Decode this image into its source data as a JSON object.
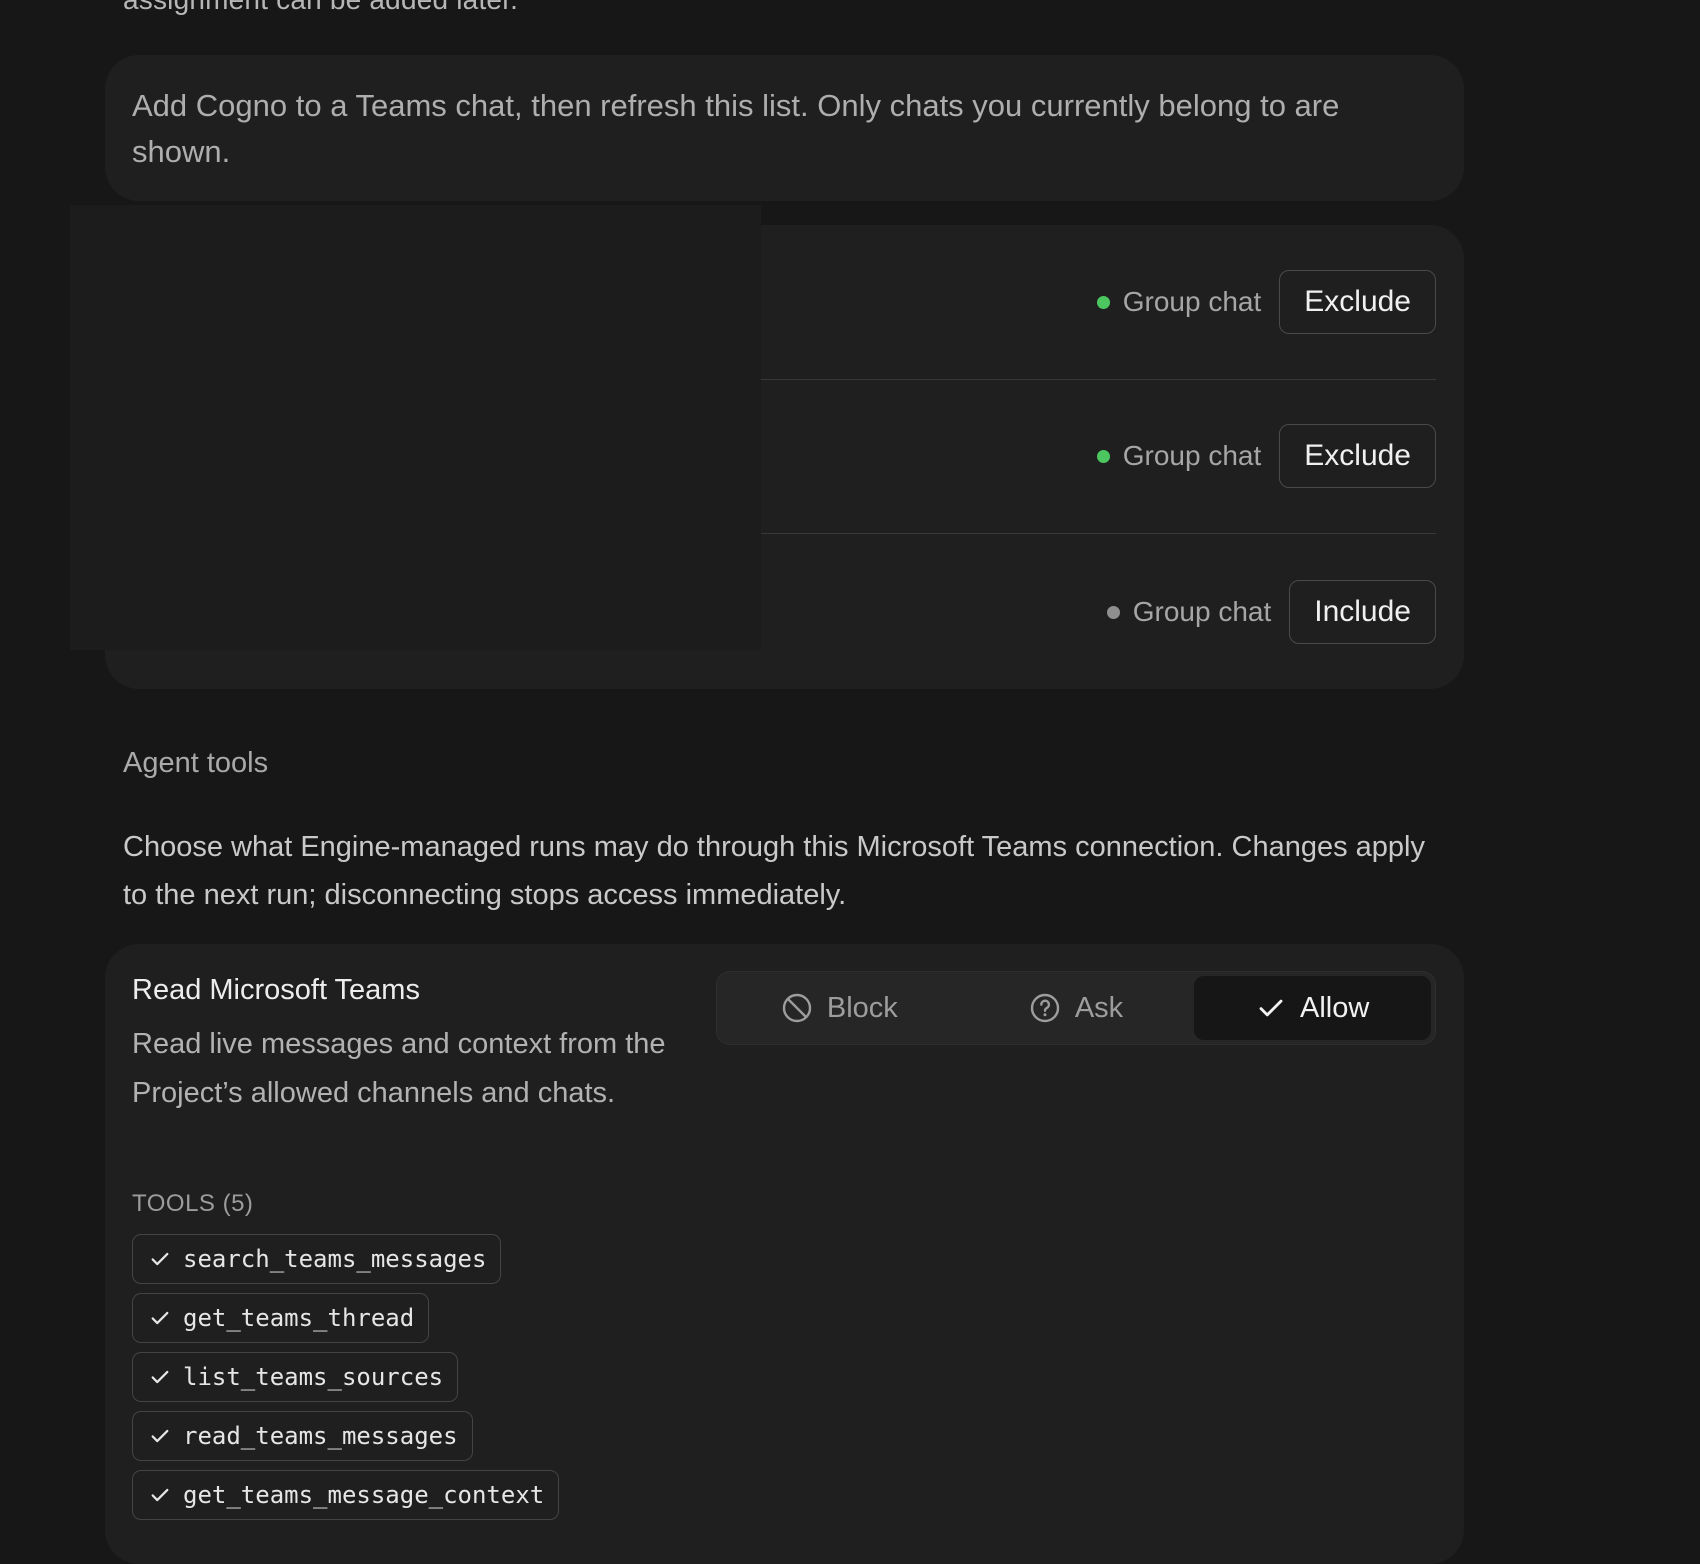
{
  "top_clip_text": "assignment can be added later.",
  "info_text": "Add Cogno to a Teams chat, then refresh this list. Only chats you currently belong to are shown.",
  "chats": [
    {
      "status": "Group chat",
      "status_color": "#4cc760",
      "action": "Exclude"
    },
    {
      "status": "Group chat",
      "status_color": "#4cc760",
      "action": "Exclude"
    },
    {
      "status": "Group chat",
      "status_color": "#8f8f8f",
      "action": "Include"
    }
  ],
  "agent_tools": {
    "title": "Agent tools",
    "description": "Choose what Engine-managed runs may do through this Microsoft Teams connection. Changes apply to the next run; disconnecting stops access immediately."
  },
  "tool_group": {
    "title": "Read Microsoft Teams",
    "description": "Read live messages and context from the Project’s allowed channels and chats.",
    "tools_label": "TOOLS (5)",
    "tools": [
      "search_teams_messages",
      "get_teams_thread",
      "list_teams_sources",
      "read_teams_messages",
      "get_teams_message_context"
    ],
    "permission": {
      "block": "Block",
      "ask": "Ask",
      "allow": "Allow",
      "selected": "Allow"
    }
  }
}
